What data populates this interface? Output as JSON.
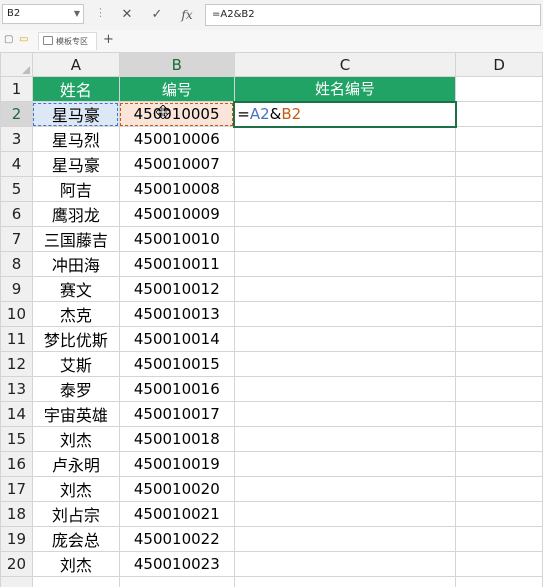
{
  "formula_bar": {
    "name_box": "B2",
    "cancel_icon": "close-icon",
    "enter_icon": "check-icon",
    "fx_label": "fx",
    "formula": "=A2&B2"
  },
  "tab_strip": {
    "template_tab": "模板专区",
    "add_label": "+"
  },
  "columns": [
    "A",
    "B",
    "C",
    "D"
  ],
  "header": {
    "name": "姓名",
    "number": "编号",
    "combined": "姓名编号"
  },
  "editing": {
    "prefix": "=",
    "ref_a": "A2",
    "amp": "&",
    "ref_b": "B2"
  },
  "rows": [
    {
      "num": "1"
    },
    {
      "num": "2",
      "name": "星马豪",
      "id": "450010005"
    },
    {
      "num": "3",
      "name": "星马烈",
      "id": "450010006"
    },
    {
      "num": "4",
      "name": "星马豪",
      "id": "450010007"
    },
    {
      "num": "5",
      "name": "阿吉",
      "id": "450010008"
    },
    {
      "num": "6",
      "name": "鹰羽龙",
      "id": "450010009"
    },
    {
      "num": "7",
      "name": "三国藤吉",
      "id": "450010010"
    },
    {
      "num": "8",
      "name": "冲田海",
      "id": "450010011"
    },
    {
      "num": "9",
      "name": "赛文",
      "id": "450010012"
    },
    {
      "num": "10",
      "name": "杰克",
      "id": "450010013"
    },
    {
      "num": "11",
      "name": "梦比优斯",
      "id": "450010014"
    },
    {
      "num": "12",
      "name": "艾斯",
      "id": "450010015"
    },
    {
      "num": "13",
      "name": "泰罗",
      "id": "450010016"
    },
    {
      "num": "14",
      "name": "宇宙英雄",
      "id": "450010017"
    },
    {
      "num": "15",
      "name": "刘杰",
      "id": "450010018"
    },
    {
      "num": "16",
      "name": "卢永明",
      "id": "450010019"
    },
    {
      "num": "17",
      "name": "刘杰",
      "id": "450010020"
    },
    {
      "num": "18",
      "name": "刘占宗",
      "id": "450010021"
    },
    {
      "num": "19",
      "name": "庞会总",
      "id": "450010022"
    },
    {
      "num": "20",
      "name": "刘杰",
      "id": "450010023"
    }
  ],
  "colors": {
    "header_fill": "#21a366",
    "active_border": "#1e7145",
    "ref_a": "#4472c4",
    "ref_b": "#c55a11"
  }
}
